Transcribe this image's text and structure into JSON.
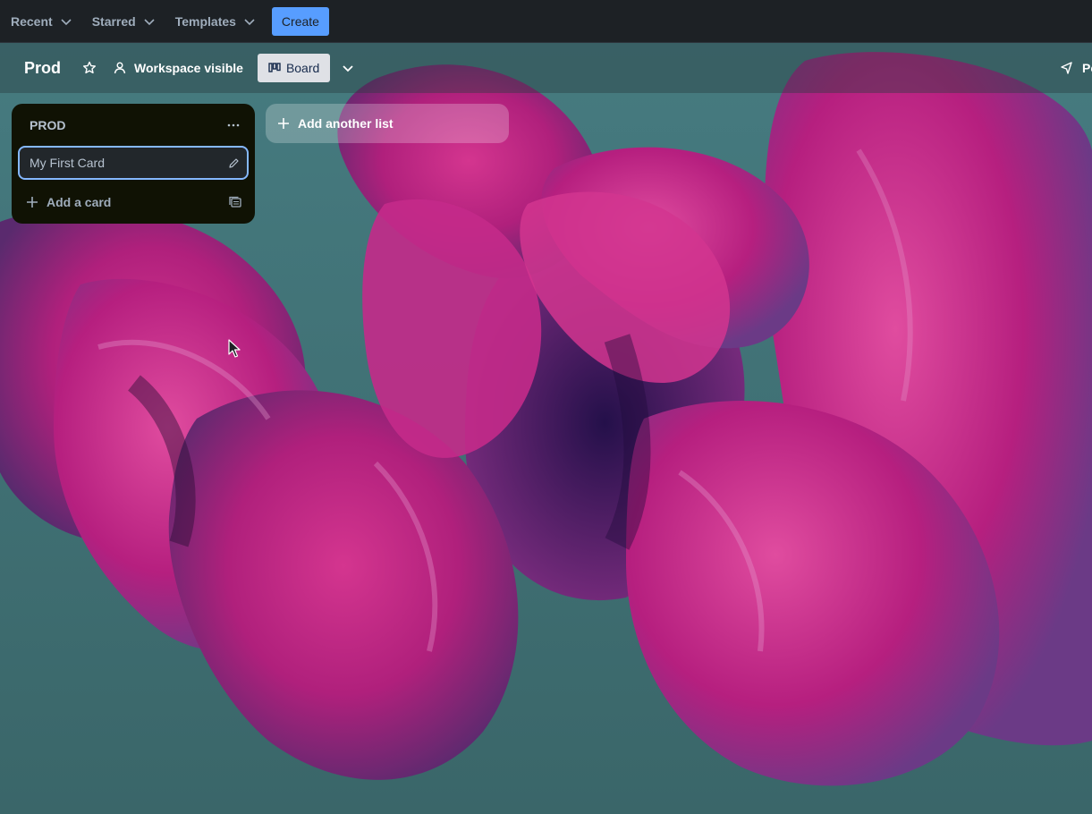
{
  "topnav": {
    "menus": [
      {
        "label": "Recent"
      },
      {
        "label": "Starred"
      },
      {
        "label": "Templates"
      }
    ],
    "create_label": "Create"
  },
  "board": {
    "title": "Prod",
    "visibility_label": "Workspace visible",
    "view_label": "Board",
    "right_label": "Po"
  },
  "lists": [
    {
      "title": "PROD",
      "cards": [
        {
          "title": "My First Card"
        }
      ],
      "add_card_label": "Add a card"
    }
  ],
  "add_list_label": "Add another list",
  "colors": {
    "nav_bg": "#1d2125",
    "create_button": "#579dff",
    "list_bg": "#101204",
    "card_bg": "#22272b",
    "card_focus_border": "#85b8ff",
    "petal_magenta": "#c21c84",
    "board_teal": "#3f6d70"
  },
  "icons": {
    "star": "star-icon",
    "visibility": "people-icon",
    "board_view": "board-icon",
    "view_switch": "chevron-down-icon",
    "list_menu": "more-horizontal-icon",
    "card_edit": "pencil-icon",
    "add": "plus-icon",
    "template": "template-icon",
    "right_action": "megaphone-icon"
  }
}
